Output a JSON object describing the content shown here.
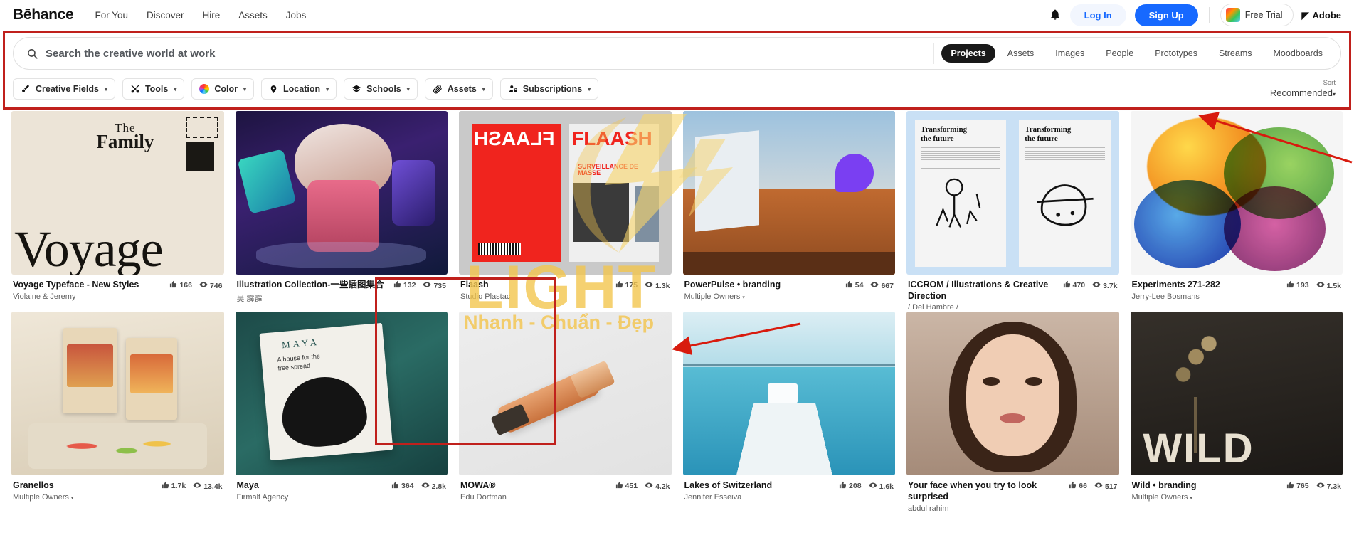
{
  "nav": {
    "logo": "Bēhance",
    "links": [
      {
        "label": "For You"
      },
      {
        "label": "Discover"
      },
      {
        "label": "Hire"
      },
      {
        "label": "Assets"
      },
      {
        "label": "Jobs"
      }
    ],
    "bell_icon": "bell-icon",
    "login_label": "Log In",
    "signup_label": "Sign Up",
    "free_trial_label": "Free Trial",
    "adobe_label": "Adobe",
    "accent_blue": "#1769ff"
  },
  "search": {
    "placeholder": "Search the creative world at work",
    "value": "",
    "icon": "search-icon",
    "tabs": [
      {
        "label": "Projects",
        "active": true
      },
      {
        "label": "Assets",
        "active": false
      },
      {
        "label": "Images",
        "active": false
      },
      {
        "label": "People",
        "active": false
      },
      {
        "label": "Prototypes",
        "active": false
      },
      {
        "label": "Streams",
        "active": false
      },
      {
        "label": "Moodboards",
        "active": false
      }
    ]
  },
  "filters": {
    "pills": [
      {
        "label": "Creative Fields",
        "icon": "creative-fields-icon"
      },
      {
        "label": "Tools",
        "icon": "tools-icon"
      },
      {
        "label": "Color",
        "icon": "color-wheel-icon"
      },
      {
        "label": "Location",
        "icon": "location-pin-icon"
      },
      {
        "label": "Schools",
        "icon": "schools-icon"
      },
      {
        "label": "Assets",
        "icon": "paperclip-icon"
      },
      {
        "label": "Subscriptions",
        "icon": "subscriptions-icon"
      }
    ],
    "caret": "▾",
    "sort_label": "Sort",
    "sort_value": "Recommended"
  },
  "watermark": {
    "text": "LIGHT",
    "subtitle": "Nhanh - Chuẩn - Đẹp",
    "color": "#f3c54e"
  },
  "annotations": {
    "box_color": "#c0201c",
    "arrow_color": "#d81b0e"
  },
  "projects": [
    {
      "title": "Voyage Typeface - New Styles",
      "owner": "Violaine & Jeremy",
      "likes": "166",
      "views": "746",
      "art": "t-voyage",
      "multi_owner": false
    },
    {
      "title": "Illustration Collection-一些插图集合",
      "owner": "吴 霹霹",
      "likes": "132",
      "views": "735",
      "art": "t-illus",
      "multi_owner": false
    },
    {
      "title": "Flaash",
      "owner": "Studio Plastac",
      "likes": "175",
      "views": "1.3k",
      "art": "t-flaash",
      "multi_owner": false
    },
    {
      "title": "PowerPulse • branding",
      "owner": "Multiple Owners",
      "likes": "54",
      "views": "667",
      "art": "t-power",
      "multi_owner": true
    },
    {
      "title": "ICCROM / Illustrations & Creative Direction",
      "owner": "/ Del Hambre /",
      "likes": "470",
      "views": "3.7k",
      "art": "t-iccrom",
      "multi_owner": false
    },
    {
      "title": "Experiments 271-282",
      "owner": "Jerry-Lee Bosmans",
      "likes": "193",
      "views": "1.5k",
      "art": "t-exper",
      "multi_owner": false
    },
    {
      "title": "Granellos",
      "owner": "Multiple Owners",
      "likes": "1.7k",
      "views": "13.4k",
      "art": "t-gran",
      "multi_owner": true
    },
    {
      "title": "Maya",
      "owner": "Firmalt Agency",
      "likes": "364",
      "views": "2.8k",
      "art": "t-maya",
      "multi_owner": false
    },
    {
      "title": "MOWA®",
      "owner": "Edu Dorfman",
      "likes": "451",
      "views": "4.2k",
      "art": "t-mowa",
      "multi_owner": false
    },
    {
      "title": "Lakes of Switzerland",
      "owner": "Jennifer Esseiva",
      "likes": "208",
      "views": "1.6k",
      "art": "t-lakes",
      "multi_owner": false
    },
    {
      "title": "Your face when you try to look surprised",
      "owner": "abdul rahim",
      "likes": "66",
      "views": "517",
      "art": "t-face",
      "multi_owner": false
    },
    {
      "title": "Wild • branding",
      "owner": "Multiple Owners",
      "likes": "765",
      "views": "7.3k",
      "art": "t-wild",
      "multi_owner": true
    }
  ],
  "thumb_art_text": {
    "voyage_top1": "The",
    "voyage_top2": "Family",
    "voyage_main": "Voyage",
    "flaash_left": "FLAASH",
    "flaash_right": "FLAASH",
    "flaash_sub": "SURVEILLANCE DE MASSE",
    "iccrom_head1": "Transforming",
    "iccrom_head2": "the future",
    "maya_line1": "A house for the",
    "maya_line2": "free spread",
    "maya_brand": "MAYA",
    "wild_text": "WILD"
  }
}
